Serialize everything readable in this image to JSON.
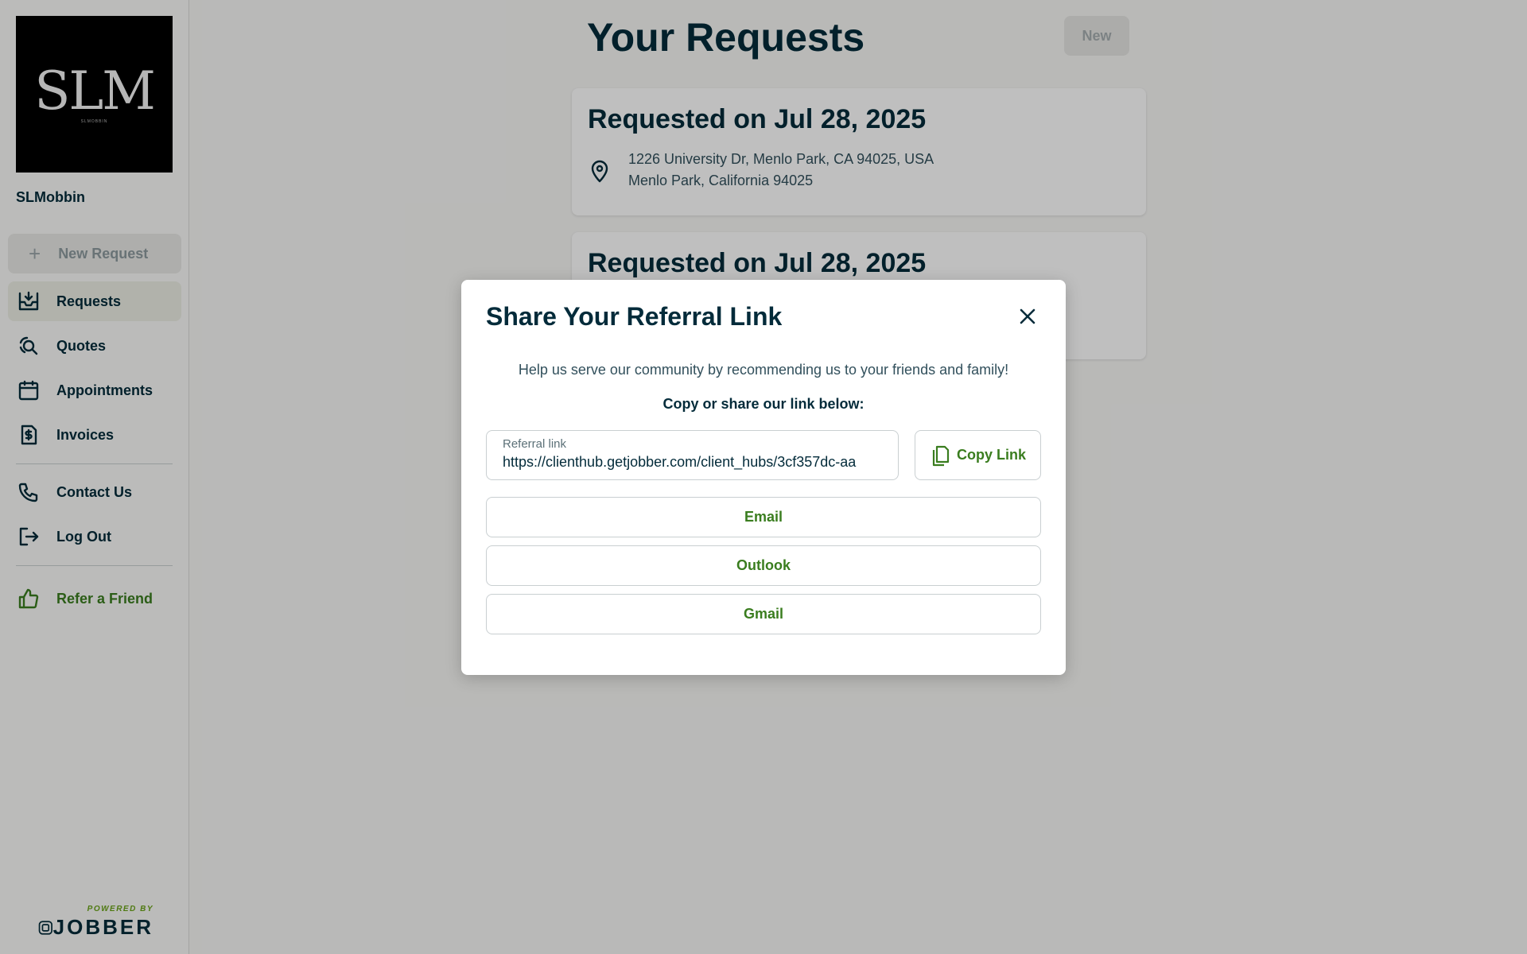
{
  "sidebar": {
    "logo_text": "SLM",
    "logo_subtext": "SLMOBBIN",
    "company_name": "SLMobbin",
    "new_request_label": "New Request",
    "nav": {
      "requests": "Requests",
      "quotes": "Quotes",
      "appointments": "Appointments",
      "invoices": "Invoices",
      "contact": "Contact Us",
      "logout": "Log Out",
      "refer": "Refer a Friend"
    },
    "powered_by": "POWERED BY",
    "jobber": "JOBBER"
  },
  "main": {
    "title": "Your Requests",
    "new_button": "New",
    "requests": [
      {
        "title": "Requested on Jul 28, 2025",
        "address_line1": "1226 University Dr, Menlo Park, CA 94025, USA",
        "address_line2": "Menlo Park, California 94025"
      },
      {
        "title": "Requested on Jul 28, 2025"
      }
    ]
  },
  "modal": {
    "title": "Share Your Referral Link",
    "help_text": "Help us serve our community by recommending us to your friends and family!",
    "copy_text": "Copy or share our link below:",
    "link_label": "Referral link",
    "link_value": "https://clienthub.getjobber.com/client_hubs/3cf357dc-aa",
    "copy_button": "Copy Link",
    "share_buttons": {
      "email": "Email",
      "outlook": "Outlook",
      "gmail": "Gmail"
    }
  },
  "colors": {
    "primary_text": "#032b3a",
    "accent_green": "#3a7d1f",
    "active_nav_bg": "#eceee4"
  }
}
